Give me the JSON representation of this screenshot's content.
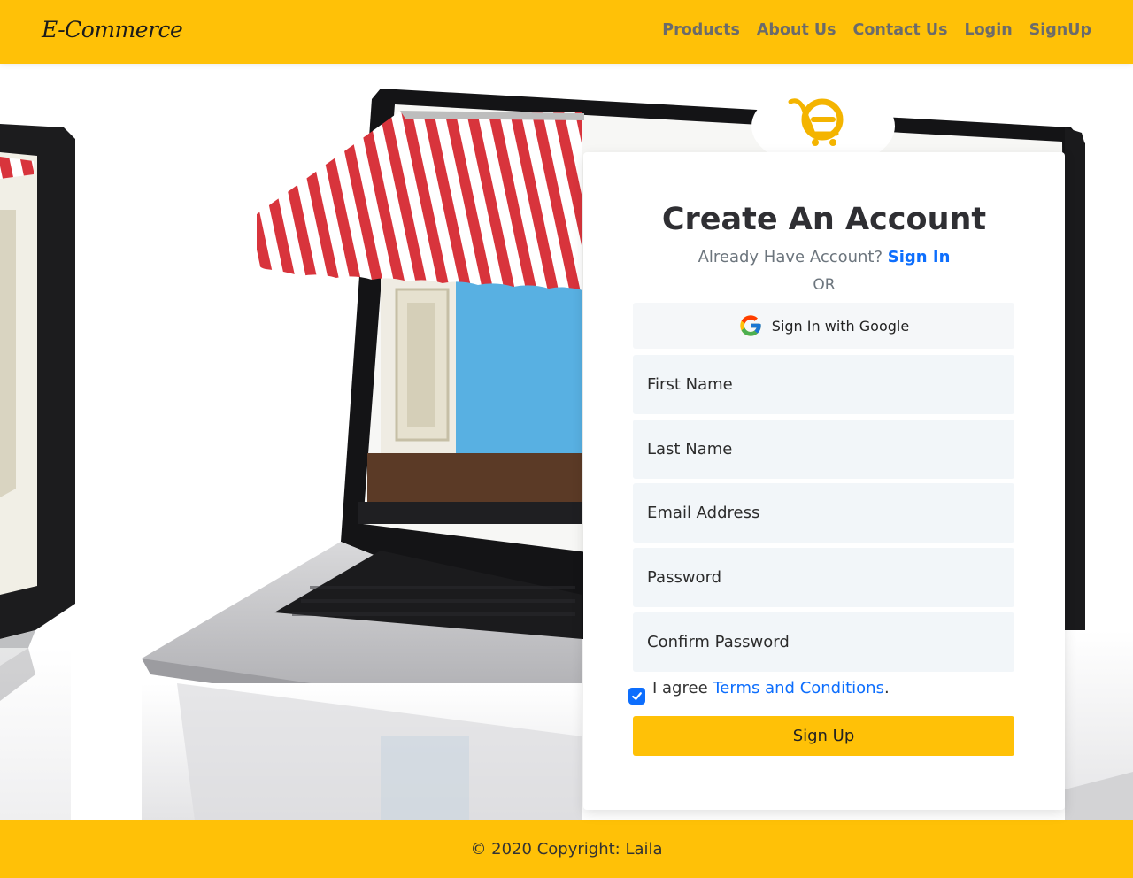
{
  "navbar": {
    "brand": "E-Commerce",
    "links": [
      "Products",
      "About Us",
      "Contact Us",
      "Login",
      "SignUp"
    ]
  },
  "card": {
    "title": "Create An Account",
    "already_text": "Already Have Account?",
    "signin_label": "Sign In",
    "or_text": "OR",
    "google_label": "Sign In with Google",
    "fields": {
      "first_name": "First Name",
      "last_name": "Last Name",
      "email": "Email Address",
      "password": "Password",
      "confirm_password": "Confirm Password"
    },
    "agree_prefix": "I agree",
    "terms_label": "Terms and Conditions",
    "agree_suffix": ".",
    "agree_checked": true,
    "signup_label": "Sign Up"
  },
  "footer": {
    "copyright": "© 2020 Copyright: Laila"
  },
  "colors": {
    "accent": "#ffc107",
    "link": "#0d6efd",
    "field_bg": "#f2f6f9"
  }
}
